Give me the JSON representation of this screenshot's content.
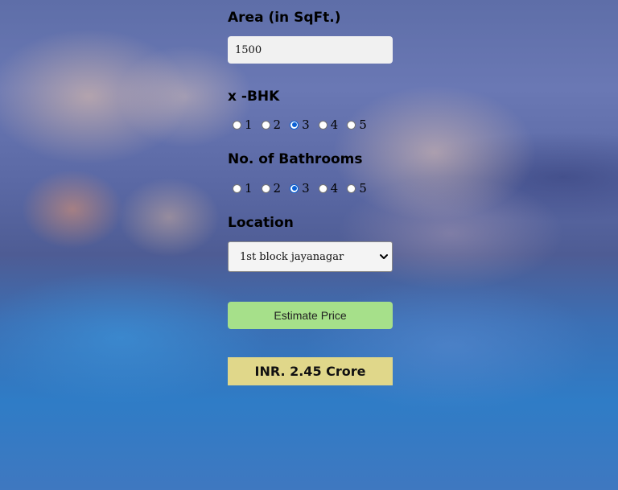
{
  "area": {
    "label": "Area (in SqFt.)",
    "value": "1500"
  },
  "bhk": {
    "label": "x -BHK",
    "options": [
      "1",
      "2",
      "3",
      "4",
      "5"
    ],
    "selected": "3"
  },
  "bathrooms": {
    "label": "No. of Bathrooms",
    "options": [
      "1",
      "2",
      "3",
      "4",
      "5"
    ],
    "selected": "3"
  },
  "location": {
    "label": "Location",
    "selected": "1st block jayanagar"
  },
  "estimate_button": {
    "label": "Estimate Price"
  },
  "result": {
    "text": "INR. 2.45 Crore"
  },
  "colors": {
    "button_green": "#a6e08a",
    "result_yellow": "#e0d78a",
    "radio_checked": "#0b62d6"
  },
  "icons": {
    "select_chevron": "chevron-down-icon"
  }
}
